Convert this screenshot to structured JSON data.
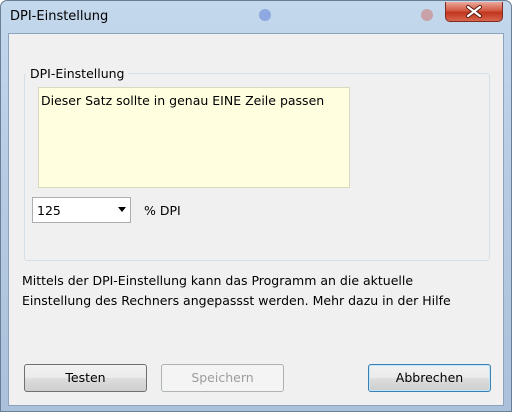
{
  "window": {
    "title": "DPI-Einstellung"
  },
  "group": {
    "label": "DPI-Einstellung",
    "sample_text": "Dieser Satz sollte in genau EINE Zeile passen",
    "dpi_value": "125",
    "dpi_unit": "% DPI"
  },
  "description": {
    "line1": "Mittels der DPI-Einstellung kann das Programm an die aktuelle",
    "line2": "Einstellung des Rechners angepassst werden. Mehr dazu in der Hilfe"
  },
  "buttons": {
    "test_label": "Testen",
    "save_label": "Speichern",
    "cancel_label": "Abbrechen"
  },
  "colors": {
    "sample_background": "#ffffe0",
    "client_background": "#f0f0f0",
    "close_button": "#c1351d"
  }
}
